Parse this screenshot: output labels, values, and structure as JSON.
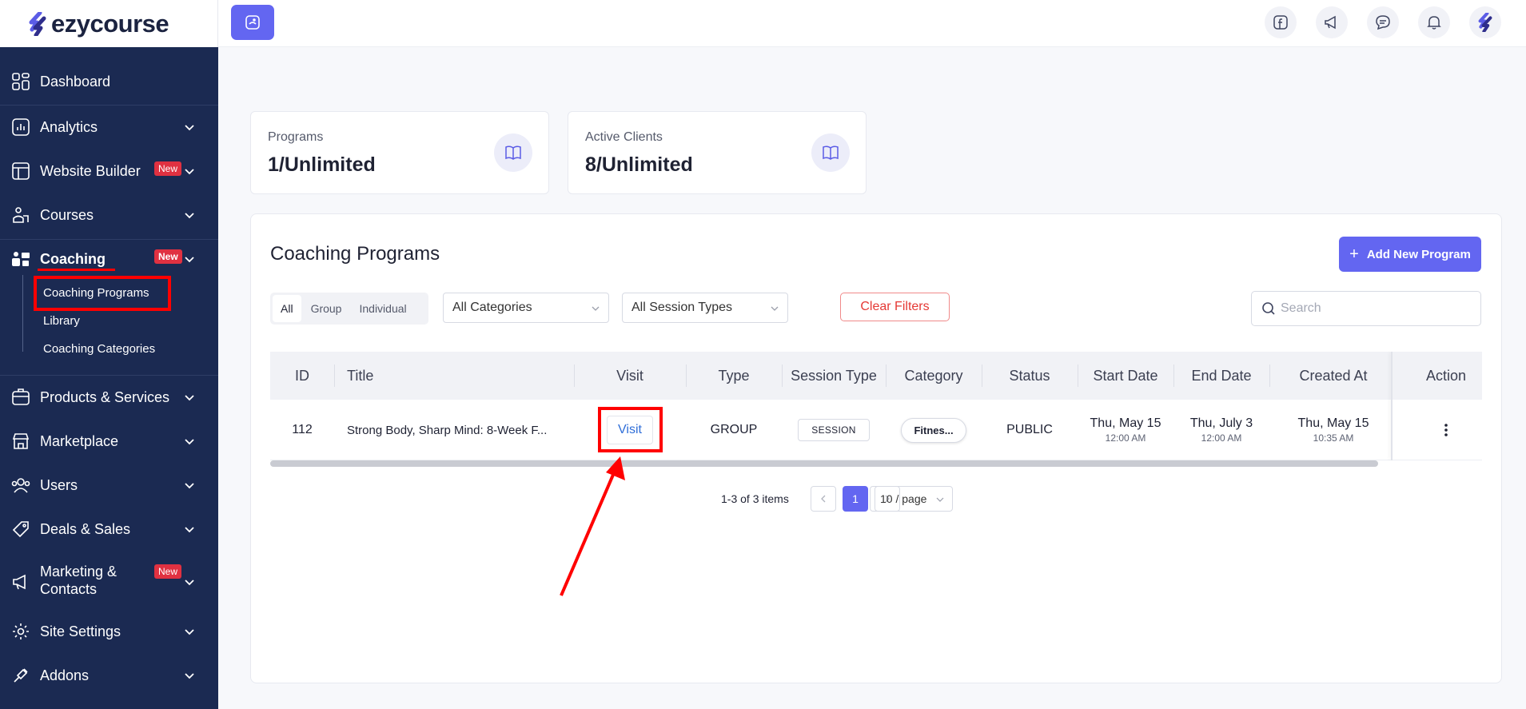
{
  "brand": {
    "name": "ezycourse"
  },
  "sidebar": {
    "items": [
      {
        "label": "Dashboard",
        "icon": "dashboard-icon",
        "chevron": false,
        "badge": ""
      },
      {
        "label": "Analytics",
        "icon": "analytics-icon",
        "chevron": true,
        "badge": ""
      },
      {
        "label": "Website Builder",
        "icon": "website-builder-icon",
        "chevron": true,
        "badge": "New"
      },
      {
        "label": "Courses",
        "icon": "courses-icon",
        "chevron": true,
        "badge": ""
      },
      {
        "label": "Coaching",
        "icon": "coaching-icon",
        "chevron": true,
        "badge": "New"
      },
      {
        "label": "Products & Services",
        "icon": "products-icon",
        "chevron": true,
        "badge": ""
      },
      {
        "label": "Marketplace",
        "icon": "marketplace-icon",
        "chevron": true,
        "badge": ""
      },
      {
        "label": "Users",
        "icon": "users-icon",
        "chevron": true,
        "badge": ""
      },
      {
        "label": "Deals & Sales",
        "icon": "deals-icon",
        "chevron": true,
        "badge": ""
      },
      {
        "label_line1": "Marketing &",
        "label_line2": "Contacts",
        "icon": "megaphone-icon",
        "chevron": true,
        "badge": "New"
      },
      {
        "label": "Site Settings",
        "icon": "settings-icon",
        "chevron": true,
        "badge": ""
      },
      {
        "label": "Addons",
        "icon": "addons-icon",
        "chevron": true,
        "badge": ""
      }
    ],
    "coaching_sub": [
      "Coaching Programs",
      "Library",
      "Coaching Categories"
    ]
  },
  "topbar": {
    "icons": [
      "facebook-icon",
      "announcement-icon",
      "chat-icon",
      "bell-icon",
      "profile-logo-icon"
    ]
  },
  "stats": [
    {
      "label": "Programs",
      "value": "1/Unlimited"
    },
    {
      "label": "Active Clients",
      "value": "8/Unlimited"
    }
  ],
  "panel": {
    "title": "Coaching Programs",
    "add_button": "Add New Program",
    "segments": [
      "All",
      "Group",
      "Individual"
    ],
    "category_select": "All Categories",
    "session_select": "All Session Types",
    "clear_filters": "Clear Filters",
    "search_placeholder": "Search"
  },
  "table": {
    "columns": [
      "ID",
      "Title",
      "Visit",
      "Type",
      "Session Type",
      "Category",
      "Status",
      "Start Date",
      "End Date",
      "Created At",
      "Action"
    ],
    "rows": [
      {
        "id": "112",
        "title": "Strong Body, Sharp Mind: 8-Week F...",
        "visit": "Visit",
        "type": "GROUP",
        "session_type": "SESSION",
        "category": "Fitnes...",
        "status": "PUBLIC",
        "start_date": "Thu, May 15",
        "start_time": "12:00 AM",
        "end_date": "Thu, July 3",
        "end_time": "12:00 AM",
        "created_date": "Thu, May 15",
        "created_time": "10:35 AM"
      }
    ]
  },
  "pagination": {
    "summary": "1-3 of 3 items",
    "current": "1",
    "page_size": "10 / page"
  },
  "colors": {
    "sidebar": "#1b2a52",
    "accent": "#6366f1",
    "danger": "#e53935",
    "annotation": "#ff0000"
  }
}
